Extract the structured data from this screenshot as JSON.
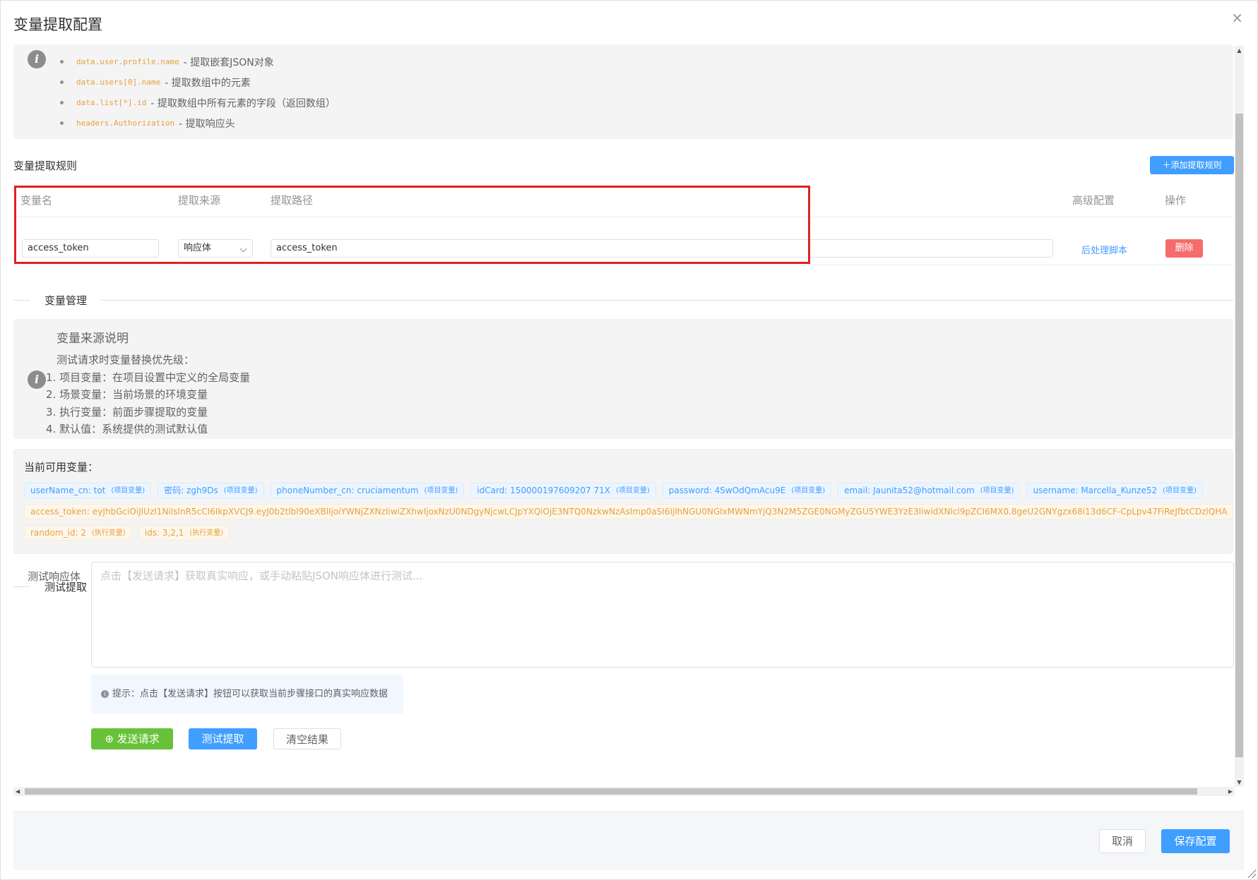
{
  "dialog": {
    "title": "变量提取配置",
    "close_glyph": "×"
  },
  "path_examples": [
    {
      "code": "data.user.profile.name",
      "desc": "- 提取嵌套JSON对象"
    },
    {
      "code": "data.users[0].name",
      "desc": "- 提取数组中的元素"
    },
    {
      "code": "data.list[*].id",
      "desc": "- 提取数组中所有元素的字段（返回数组）"
    },
    {
      "code": "headers.Authorization",
      "desc": "- 提取响应头"
    }
  ],
  "rules": {
    "title": "变量提取规则",
    "add_button": "添加提取规则",
    "headers": {
      "name": "变量名",
      "source": "提取来源",
      "path": "提取路径",
      "advanced": "高级配置",
      "action": "操作"
    },
    "rows": [
      {
        "name": "access_token",
        "source": "响应体",
        "path": "access_token",
        "advanced_link": "后处理脚本",
        "delete": "删除"
      }
    ]
  },
  "var_management": {
    "section_title": "变量管理",
    "source_info": {
      "title": "变量来源说明",
      "lines": [
        "测试请求时变量替换优先级：",
        "1. 项目变量：在项目设置中定义的全局变量",
        "2. 场景变量：当前场景的环境变量",
        "3. 执行变量：前面步骤提取的变量",
        "4. 默认值：系统提供的测试默认值"
      ]
    },
    "available_title": "当前可用变量：",
    "row1": [
      {
        "text": "userName_cn: tot",
        "src": "(项目变量)"
      },
      {
        "text": "密码: zgh9Ds",
        "src": "(项目变量)"
      },
      {
        "text": "phoneNumber_cn: cruciamentum",
        "src": "(项目变量)"
      },
      {
        "text": "idCard: 150000197609207 71X",
        "src": "(项目变量)"
      },
      {
        "text": "password: 4SwOdQmAcu9E",
        "src": "(项目变量)"
      },
      {
        "text": "email: Jaunita52@hotmail.com",
        "src": "(项目变量)"
      },
      {
        "text": "username: Marcella_Kunze52",
        "src": "(项目变量)"
      }
    ],
    "row2": [
      {
        "text": "access_token: eyJhbGciOiJIUzI1NiIsInR5cCI6IkpXVCJ9.eyJ0b2tlbl90eXBlIjoiYWNjZXNzIiwiZXhwIjoxNzU0NDgyNjcwLCJpYXQiOjE3NTQ0NzkwNzAsImp0aSI6IjlhNGU0NGIxMWNmYjQ3N2M5ZGE0NGMyZGU5YWE3YzE3IiwidXNlcl9pZCI6MX0.8geU2GNYgzx68i13d6CF-CpLpv47FiReJfbtCDzlQHA",
        "src": "(执行变量)"
      }
    ],
    "row3": [
      {
        "text": "random_id: 2",
        "src": "(执行变量)"
      },
      {
        "text": "ids: 3,2,1",
        "src": "(执行变量)"
      }
    ]
  },
  "test_extract": {
    "section_title": "测试提取",
    "label": "测试响应体",
    "placeholder": "点击【发送请求】获取真实响应，或手动粘贴JSON响应体进行测试...",
    "tip": "提示：点击【发送请求】按钮可以获取当前步骤接口的真实响应数据",
    "send_button": "发送请求",
    "test_button": "测试提取",
    "clear_button": "清空结果"
  },
  "footer": {
    "cancel": "取消",
    "save": "保存配置"
  },
  "colors": {
    "primary": "#409eff",
    "danger": "#f56c6c",
    "success": "#67c23a",
    "warning": "#e6a23c"
  }
}
